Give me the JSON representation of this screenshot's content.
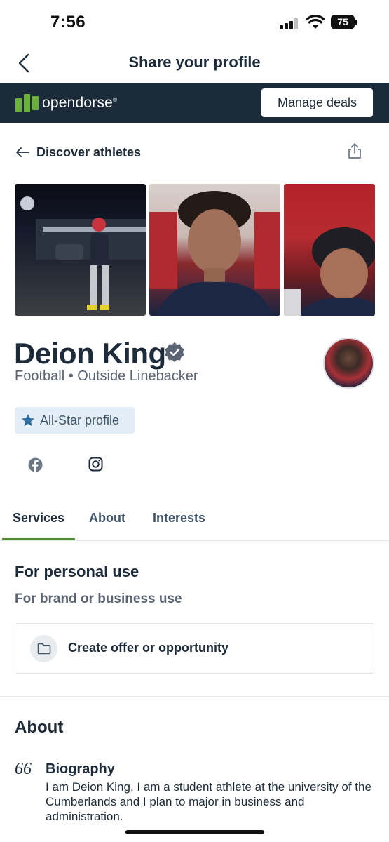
{
  "status_bar": {
    "time": "7:56",
    "battery": "75"
  },
  "nav": {
    "title": "Share your profile",
    "back_icon": "chevron-left-icon"
  },
  "brand_bar": {
    "brand_name": "opendorse",
    "trademark": "®",
    "manage_button": "Manage deals",
    "background_color": "#1c2b3a",
    "logo_color": "#6cb23a"
  },
  "discover": {
    "label": "Discover athletes",
    "icon": "arrow-left-icon",
    "share_icon": "share-icon"
  },
  "profile": {
    "name": "Deion King",
    "sport": "Football • Outside Linebacker",
    "badge": "All-Star profile",
    "verified_icon": "verified-badge-icon",
    "socials": [
      "facebook-icon",
      "instagram-icon"
    ]
  },
  "tabs": {
    "items": [
      "Services",
      "About",
      "Interests"
    ],
    "active": "Services",
    "accent_color": "#4f8a2e"
  },
  "services": {
    "personal_use": "For personal use",
    "brand_use": "For brand or business use",
    "offer_label": "Create offer or opportunity",
    "offer_icon": "folder-icon"
  },
  "about": {
    "title": "About",
    "quote_mark": "66",
    "bio_heading": "Biography",
    "bio_text": "I am Deion King, I am a student athlete at the university of the Cumberlands and I plan to major in business and administration."
  }
}
